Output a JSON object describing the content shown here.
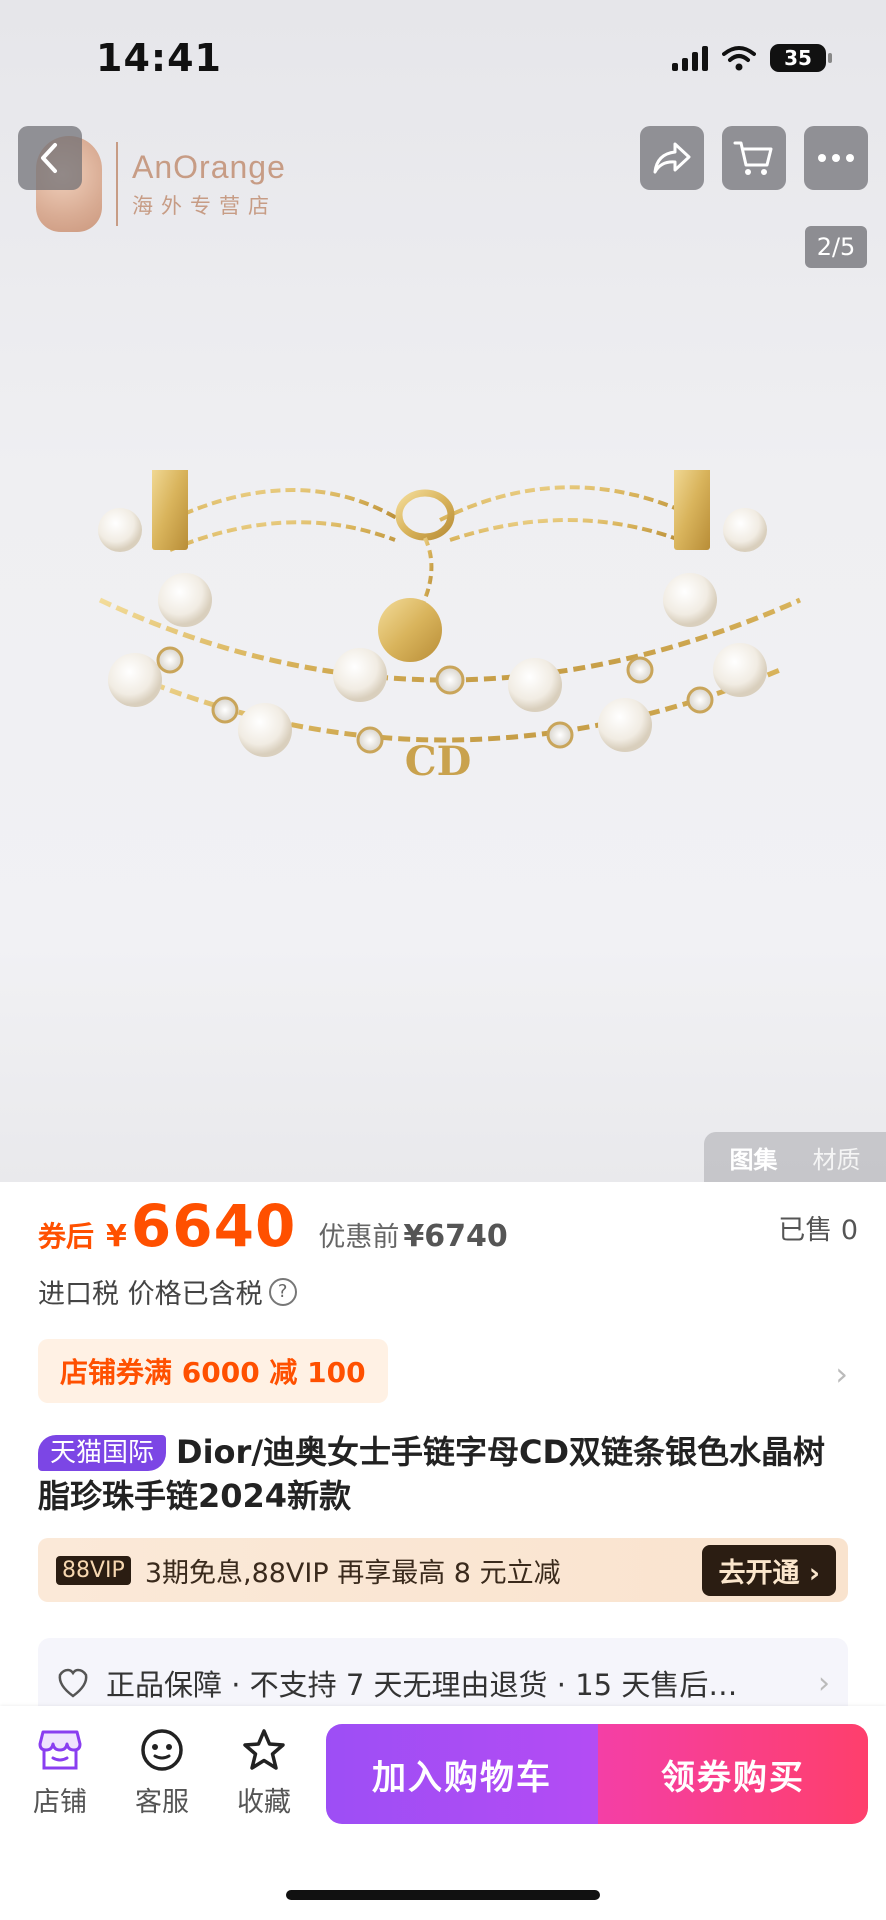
{
  "status_bar": {
    "time": "14:41",
    "battery": "35"
  },
  "gallery": {
    "page_indicator": "2/5",
    "tabs": [
      "图集",
      "材质"
    ]
  },
  "watermark": {
    "name": "AnOrange",
    "subtitle": "海外专营店"
  },
  "price": {
    "after_coupon_label": "券后",
    "currency": "¥",
    "value": "6640",
    "before_label": "优惠前",
    "before_value": "¥6740",
    "sold": "已售 0"
  },
  "tax": {
    "label": "进口税 价格已含税",
    "help_icon": "?"
  },
  "coupon": {
    "text": "店铺券满 6000 减 100",
    "arrow": "›"
  },
  "title": {
    "badge": "天猫国际",
    "text": "Dior/迪奥女士手链字母CD双链条银色水晶树脂珍珠手链2024新款"
  },
  "vip": {
    "badge": "88VIP",
    "text": "3期免息,88VIP 再享最高 8 元立减",
    "button": "去开通 ›"
  },
  "guarantee": {
    "text": "正品保障 · 不支持 7 天无理由退货 · 15 天售后…",
    "arrow": "›"
  },
  "bottom_bar": {
    "shop_label": "店铺",
    "service_label": "客服",
    "favorite_label": "收藏",
    "add_to_cart": "加入购物车",
    "buy_with_coupon": "领券购买"
  },
  "icons": [
    "back-icon",
    "share-icon",
    "cart-icon",
    "more-icon",
    "store-icon",
    "chat-icon",
    "star-icon",
    "shield-icon"
  ],
  "colors": {
    "price": "#ff5000",
    "tmall": "#7c46e5",
    "cta_cart": "#a64ef5",
    "cta_buy": "#fa3f88"
  }
}
